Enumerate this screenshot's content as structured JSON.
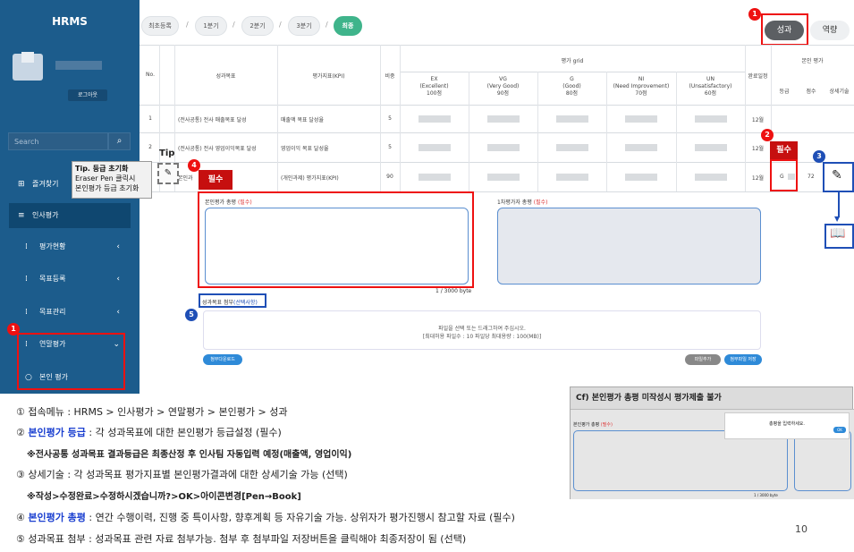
{
  "sidebar": {
    "title": "HRMS",
    "logout": "로그아웃",
    "search_placeholder": "Search",
    "items": [
      {
        "label": "즐겨찾기"
      },
      {
        "label": "인사평가"
      },
      {
        "label": "평가현황"
      },
      {
        "label": "목표등록"
      },
      {
        "label": "목표관리"
      },
      {
        "label": "연말평가"
      },
      {
        "label": "본인 평가"
      }
    ]
  },
  "steps": [
    "최초등록",
    "1분기",
    "2분기",
    "3분기",
    "최종"
  ],
  "tabs": {
    "performance": "성과",
    "competency": "역량"
  },
  "table": {
    "headers": {
      "no": "No.",
      "goal": "성과목표",
      "kpi": "평가지표(KPI)",
      "weight": "비중",
      "grid": "평가 grid",
      "due": "완료일정",
      "self": "본인 평가",
      "grade": "등급",
      "score": "점수",
      "desc": "상세기술"
    },
    "grid_cols": [
      {
        "code": "EX",
        "name": "(Excellent)",
        "pts": "100점"
      },
      {
        "code": "VG",
        "name": "(Very Good)",
        "pts": "90점"
      },
      {
        "code": "G",
        "name": "(Good)",
        "pts": "80점"
      },
      {
        "code": "NI",
        "name": "(Need Improvement)",
        "pts": "70점"
      },
      {
        "code": "UN",
        "name": "(Unsatisfactory)",
        "pts": "60점"
      }
    ],
    "rows": [
      {
        "no": "1",
        "goal": "(전사공통) 전사 매출목표 달성",
        "kpi": "매출액 목표 달성율",
        "weight": "5",
        "due": "12월",
        "grade": "",
        "score": ""
      },
      {
        "no": "2",
        "goal": "(전사공통) 전사 영업이익목표 달성",
        "kpi": "영업이익 목표 달성율",
        "weight": "5",
        "due": "12월",
        "grade": "",
        "score": ""
      },
      {
        "no": "3",
        "goal": "본인과",
        "kpi": "(개인과제) 평가지표(KPI)",
        "weight": "90",
        "due": "12월",
        "grade": "G",
        "score": "72"
      }
    ]
  },
  "tip": {
    "label": "Tip",
    "line1": "Tip. 등급 초기화",
    "line2": "Eraser Pen 클릭시",
    "line3": "본인평가 등급 초기화"
  },
  "required_tag": "필수",
  "self_summary": {
    "label": "본인평가 총평",
    "req": "(필수)",
    "counter": "1 / 3000 byte"
  },
  "first_summary": {
    "label": "1차평가자 총평",
    "req": "(필수)"
  },
  "attach": {
    "label": "성과목표 첨부",
    "opt": "(선택사항)",
    "drop1": "파일을 선택 또는 드래그하여 주십시오.",
    "drop2": "[최대허용 파일수 : 10 파일당 최대용량 : 100(MB)]",
    "download_all": "첨부다운로드",
    "add_file": "파일추가",
    "save_attach": "첨부파일 저장"
  },
  "cf": {
    "title": "Cf) 본인평가 총평 미작성시 평가제출 불가",
    "field": "본인평가 총평",
    "req": "(필수)",
    "popup": "총평을 입력하세요.",
    "ok": "OK",
    "counter": "1 / 3000 byte"
  },
  "notes": [
    "① 접속메뉴 : HRMS > 인사평가 > 연말평가 > 본인평가 > 성과",
    {
      "pre": "② ",
      "hl": "본인평가 등급",
      "post": " : 각 성과목표에 대한 본인평가 등급설정 (필수)"
    },
    "※전사공통 성과목표 결과등급은 최종산정 후 인사팀 자동입력 예정(매출액, 영업이익)",
    "③ 상세기술 : 각 성과목표 평가지표별 본인평가결과에 대한 상세기술 가능 (선택)",
    "※작성>수정완료>수정하시겠습니까?>OK>아이콘변경[Pen→Book]",
    {
      "pre": "④ ",
      "hl": "본인평가 총평",
      "post": " : 연간 수행이력, 진행 중 특이사항, 향후계획 등 자유기술 가능. 상위자가 평가진행시 참고할 자료 (필수)"
    },
    "⑤ 성과목표 첨부 : 성과목표 관련 자료 첨부가능. 첨부 후 첨부파일 저장버튼을 클릭해야 최종저장이 됨 (선택)"
  ],
  "page_number": "10",
  "colors": {
    "sidebar": "#1c5c8c",
    "accent_green": "#3fb48b",
    "callout_red": "#e11111",
    "callout_blue": "#1f4fb6"
  }
}
